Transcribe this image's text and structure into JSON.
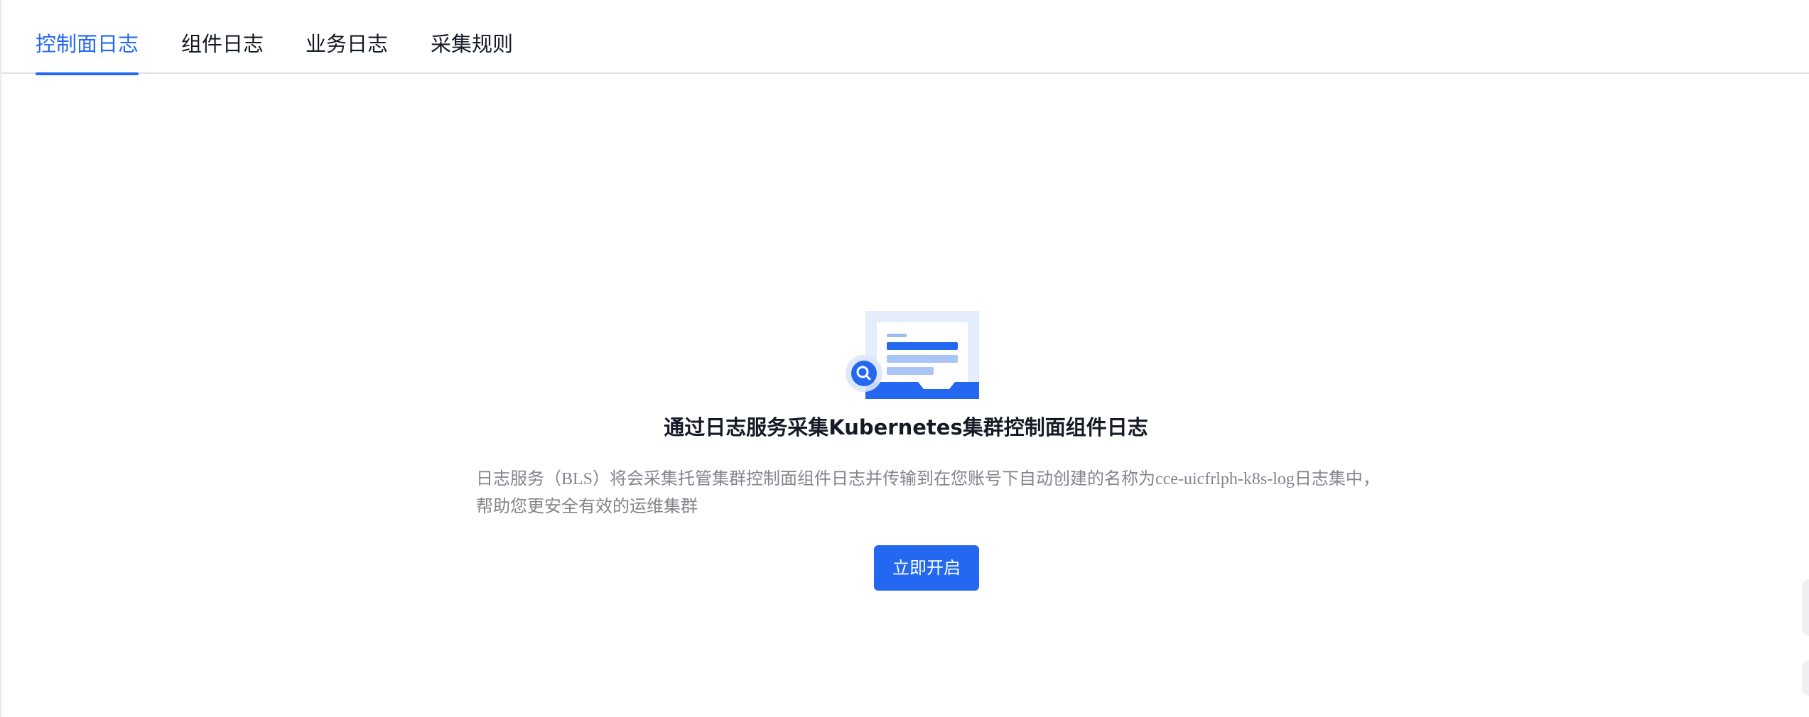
{
  "tabs": [
    {
      "label": "控制面日志",
      "active": true
    },
    {
      "label": "组件日志",
      "active": false
    },
    {
      "label": "业务日志",
      "active": false
    },
    {
      "label": "采集规则",
      "active": false
    }
  ],
  "empty_state": {
    "illustration_icon": "log-search-icon",
    "title": "通过日志服务采集Kubernetes集群控制面组件日志",
    "description": "日志服务（BLS）将会采集托管集群控制面组件日志并传输到在您账号下自动创建的名称为cce-uicfrlph-k8s-log日志集中，帮助您更安全有效的运维集群",
    "button_label": "立即开启"
  },
  "colors": {
    "accent": "#2468f2",
    "text_primary": "#151b26",
    "text_secondary": "#84868c",
    "divider": "#dfe2e8"
  }
}
